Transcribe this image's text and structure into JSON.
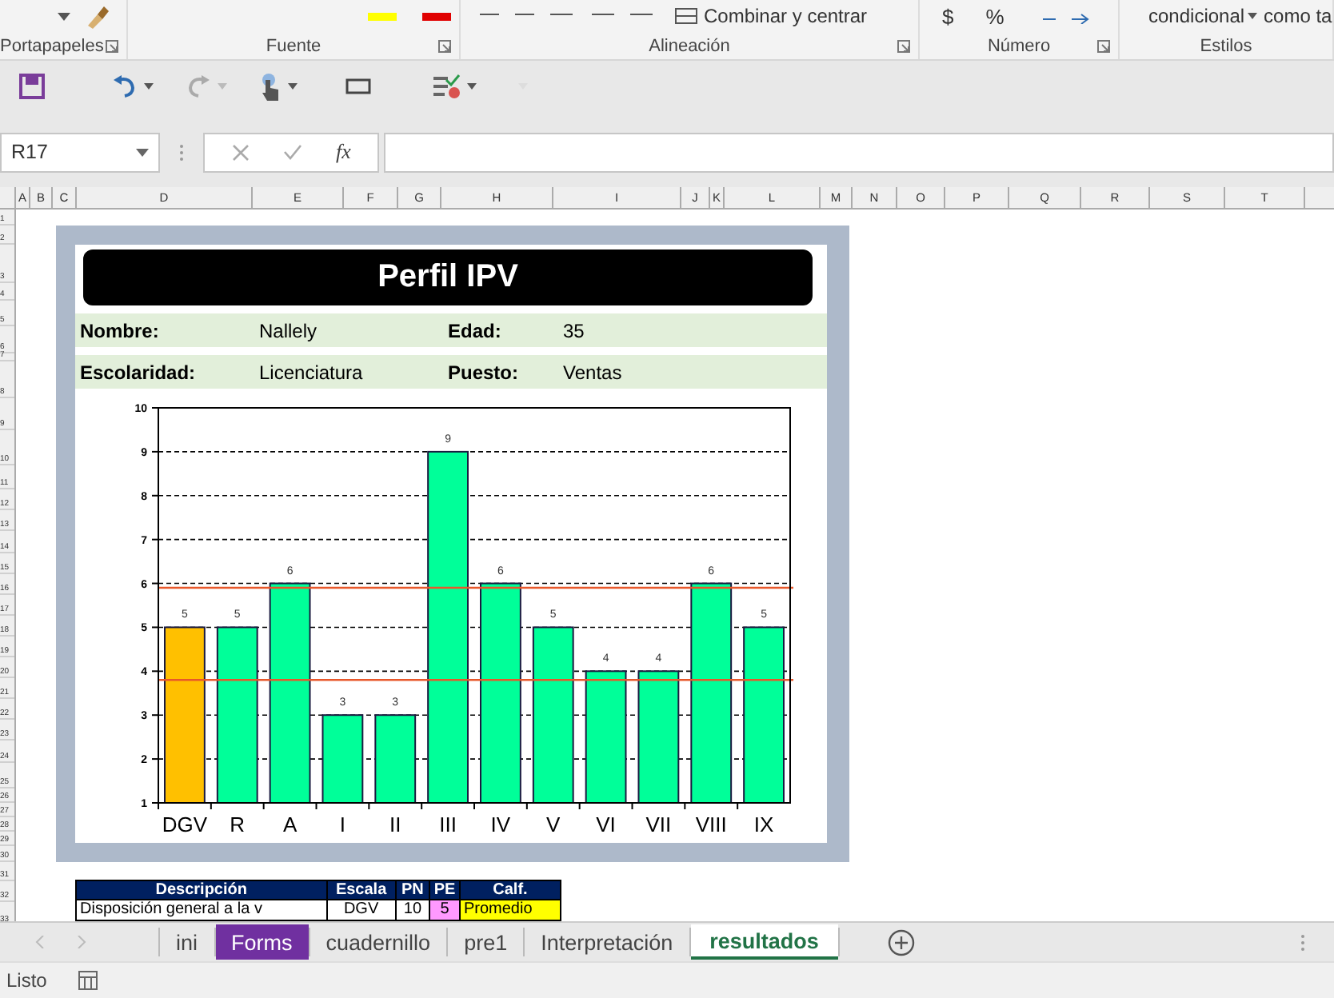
{
  "ribbon": {
    "groups": [
      {
        "label": "Portapapeles",
        "launcher": true
      },
      {
        "label": "Fuente",
        "launcher": true
      },
      {
        "label": "Alineación",
        "launcher": true
      },
      {
        "label": "Número",
        "launcher": true
      },
      {
        "label": "Estilos",
        "launcher": false
      }
    ],
    "merge_label": "Combinar y centrar",
    "number_symbols": [
      "$",
      "%"
    ],
    "conditional_format": "condicional",
    "format_as_table": "como ta"
  },
  "formula_bar": {
    "name_box": "R17",
    "function_label": "fx"
  },
  "column_headers": [
    "A",
    "B",
    "C",
    "D",
    "E",
    "F",
    "G",
    "H",
    "I",
    "J",
    "K",
    "L",
    "M",
    "N",
    "O",
    "P",
    "Q",
    "R",
    "S",
    "T"
  ],
  "row_headers": [
    "1",
    "2",
    "3",
    "4",
    "5",
    "6",
    "7",
    "8",
    "9",
    "10",
    "11",
    "12",
    "13",
    "14",
    "15",
    "16",
    "17",
    "18",
    "19",
    "20",
    "21",
    "22",
    "23",
    "24",
    "25",
    "26",
    "27",
    "28",
    "29",
    "30",
    "31",
    "32",
    "33"
  ],
  "report": {
    "title": "Perfil IPV",
    "info_rows": [
      [
        {
          "label": "Nombre:",
          "value": "Nallely"
        },
        {
          "label": "Edad:",
          "value": "35"
        }
      ],
      [
        {
          "label": "Escolaridad:",
          "value": "Licenciatura"
        },
        {
          "label": "Puesto:",
          "value": "Ventas"
        }
      ]
    ],
    "chart_data": {
      "type": "bar",
      "categories": [
        "DGV",
        "R",
        "A",
        "I",
        "II",
        "III",
        "IV",
        "V",
        "VI",
        "VII",
        "VIII",
        "IX"
      ],
      "series": [
        {
          "color": "#ffc000",
          "values": [
            5,
            null,
            null,
            null,
            null,
            null,
            null,
            null,
            null,
            null,
            null,
            null
          ]
        },
        {
          "color": "#00ff99",
          "values": [
            null,
            5,
            6,
            3,
            3,
            9,
            6,
            5,
            4,
            4,
            6,
            5
          ]
        }
      ],
      "stacked": true,
      "ylim": [
        1,
        10
      ],
      "yticks": [
        1,
        2,
        3,
        4,
        5,
        6,
        7,
        8,
        9,
        10
      ],
      "data_labels": true,
      "grid": true,
      "ref_lines": [
        {
          "axis": "y",
          "value": 5.9,
          "color": "#e8572a"
        },
        {
          "axis": "y",
          "value": 3.8,
          "color": "#e8572a"
        }
      ]
    }
  },
  "score_table": {
    "columns": [
      "Descripción",
      "Escala",
      "PN",
      "PE",
      "Calf."
    ],
    "rows": [
      {
        "cells": [
          {
            "text": "Disposición general a la v"
          },
          {
            "text": "DGV"
          },
          {
            "text": "10"
          },
          {
            "text": "5",
            "color": "#ff99ff"
          },
          {
            "text": "Promedio",
            "color": "#ffff00"
          }
        ]
      }
    ]
  },
  "sheet_tabs": [
    {
      "label": "ini",
      "selected": false
    },
    {
      "label": "Forms",
      "selected": false,
      "color": "#7030a0"
    },
    {
      "label": "cuadernillo",
      "selected": false
    },
    {
      "label": "pre1",
      "selected": false
    },
    {
      "label": "Interpretación",
      "selected": false
    },
    {
      "label": "resultados",
      "selected": true
    }
  ],
  "status_bar": {
    "text": "Listo"
  }
}
